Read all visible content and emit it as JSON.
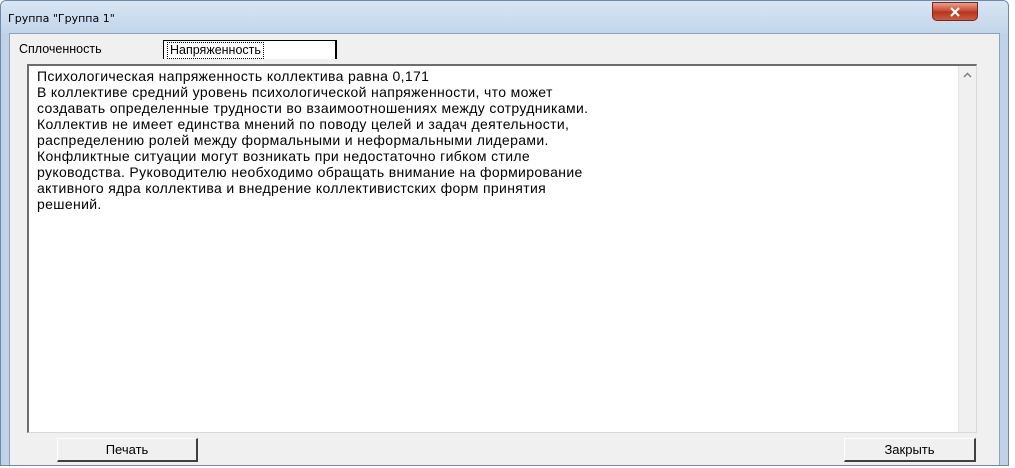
{
  "window": {
    "title": "Группа \"Группа 1\""
  },
  "tabs": [
    {
      "label": "Сплоченность",
      "selected": false
    },
    {
      "label": "Напряженность",
      "selected": true
    }
  ],
  "report": {
    "lines": [
      "Психологическая напряженность коллектива равна 0,171",
      "В коллективе средний уровень психологической напряженности, что может",
      "создавать определенные трудности во взаимоотношениях между сотрудниками.",
      "Коллектив не имеет единства мнений по поводу целей и задач деятельности,",
      "распределению ролей между формальными и неформальными лидерами.",
      "Конфликтные ситуации могут возникать при недостаточно гибком стиле",
      "руководства. Руководителю необходимо обращать внимание на формирование",
      "активного ядра коллектива и внедрение коллективистских форм принятия",
      "решений."
    ]
  },
  "buttons": {
    "print_label": "Печать",
    "close_label": "Закрыть"
  },
  "icons": {
    "window_close": "close-icon",
    "scroll_up": "scroll-up-arrow-icon"
  },
  "colors": {
    "frame": "#bfd2e8",
    "close_button": "#c9422a",
    "dialog_background": "#f0f0f0"
  }
}
